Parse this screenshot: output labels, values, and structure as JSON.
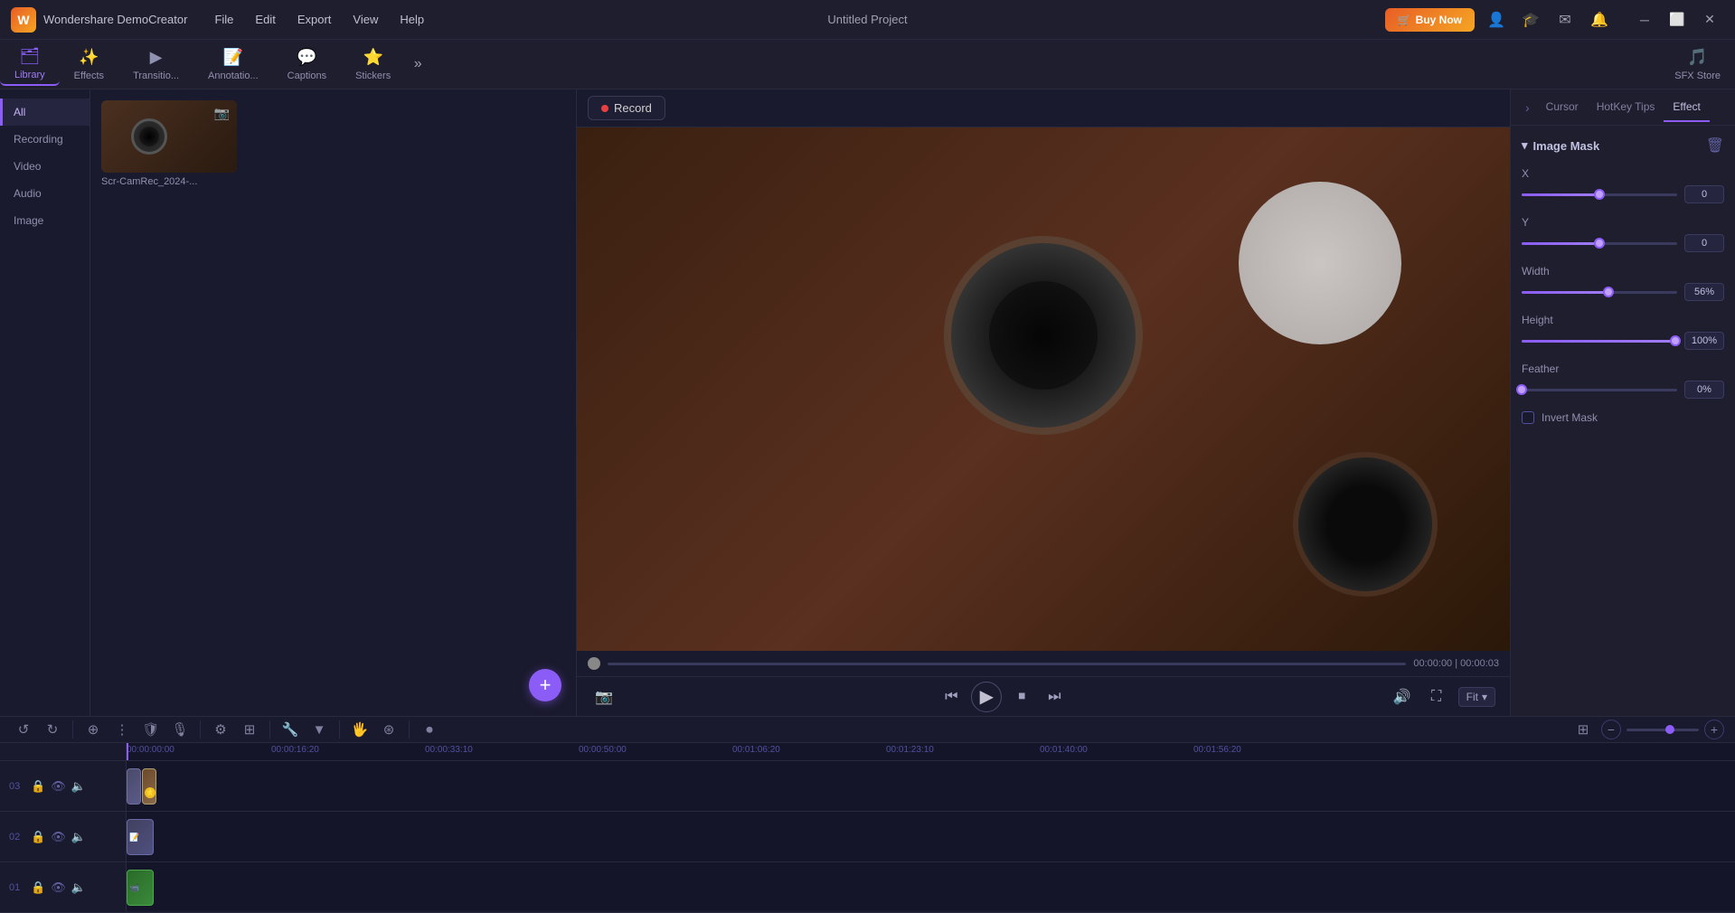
{
  "app": {
    "name": "Wondershare DemoCreator",
    "title": "Untitled Project"
  },
  "menu": {
    "items": [
      "File",
      "Edit",
      "Export",
      "View",
      "Help"
    ]
  },
  "titlebar": {
    "buy_now": "Buy Now",
    "min": "─",
    "max": "⬜",
    "close": "✕"
  },
  "toolbar": {
    "items": [
      {
        "id": "library",
        "label": "Library",
        "icon": "🗂",
        "active": true
      },
      {
        "id": "effects",
        "label": "Effects",
        "icon": "✨"
      },
      {
        "id": "transitions",
        "label": "Transitio...",
        "icon": "▶"
      },
      {
        "id": "annotations",
        "label": "Annotatio...",
        "icon": "📝"
      },
      {
        "id": "captions",
        "label": "Captions",
        "icon": "💬"
      },
      {
        "id": "stickers",
        "label": "Stickers",
        "icon": "⭐"
      },
      {
        "id": "sfxstore",
        "label": "SFX Store",
        "icon": "🎵"
      }
    ],
    "more_icon": "»"
  },
  "sidebar": {
    "items": [
      "All",
      "Recording",
      "Video",
      "Audio",
      "Image"
    ]
  },
  "media": {
    "items": [
      {
        "name": "Scr-CamRec_2024-...",
        "thumb_type": "camera"
      }
    ]
  },
  "record_button": "Record",
  "preview": {
    "time_current": "00:00:00",
    "time_total": "00:00:03",
    "fit_label": "Fit"
  },
  "right_panel": {
    "tabs": [
      "Cursor",
      "HotKey Tips",
      "Effect"
    ],
    "active_tab": "Effect",
    "arrow": "›",
    "section": {
      "title": "Image Mask",
      "params": [
        {
          "label": "X",
          "value": "0",
          "fill_pct": 50
        },
        {
          "label": "Y",
          "value": "0",
          "fill_pct": 50
        },
        {
          "label": "Width",
          "value": "56%",
          "fill_pct": 56
        },
        {
          "label": "Height",
          "value": "100%",
          "fill_pct": 100
        },
        {
          "label": "Feather",
          "value": "0%",
          "fill_pct": 0
        }
      ],
      "invert_label": "Invert Mask"
    }
  },
  "timeline": {
    "toolbar_btns": [
      "↺",
      "↻",
      "⊕",
      "⋮",
      "🛡",
      "🎙",
      "⚙",
      "⊞",
      "🔧",
      "▼",
      "🖐",
      "⊛"
    ],
    "tracks": [
      {
        "num": "03",
        "label": ""
      },
      {
        "num": "02",
        "label": ""
      },
      {
        "num": "01",
        "label": ""
      }
    ],
    "ruler_times": [
      "00:00:00:00",
      "00:00:16:20",
      "00:00:33:10",
      "00:00:50:00",
      "00:01:06:20",
      "00:01:23:10",
      "00:01:40:00",
      "00:01:56:20"
    ]
  }
}
